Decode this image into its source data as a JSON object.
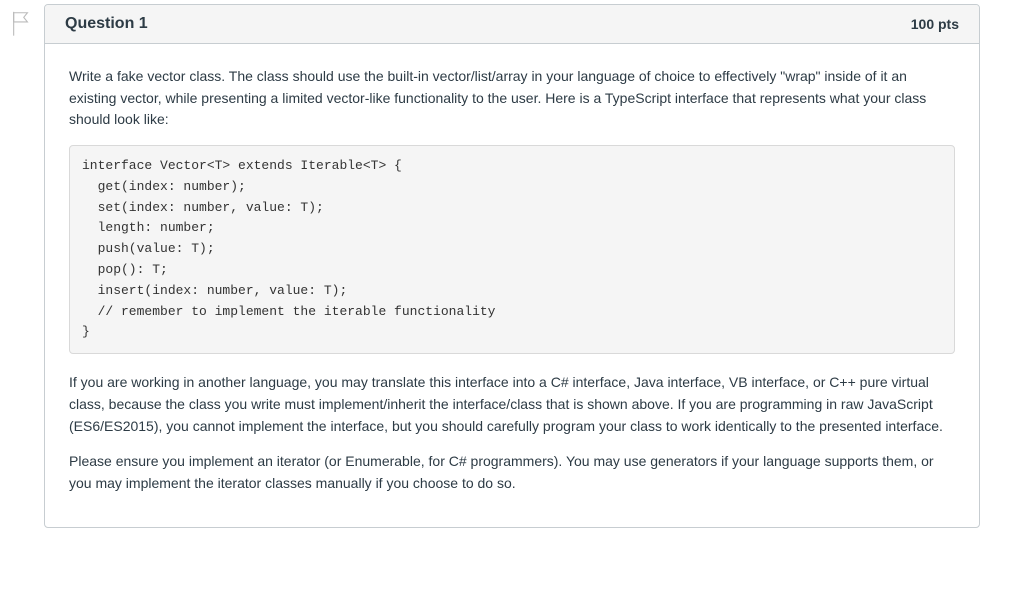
{
  "header": {
    "title": "Question 1",
    "points": "100 pts"
  },
  "content": {
    "intro": "Write a fake vector class. The class should use the built-in vector/list/array in your language of choice to effectively \"wrap\" inside of it an existing vector, while presenting a limited vector-like functionality to the user. Here is a TypeScript interface that represents what your class should look like:",
    "code": "interface Vector<T> extends Iterable<T> {\n  get(index: number);\n  set(index: number, value: T);\n  length: number;\n  push(value: T);\n  pop(): T;\n  insert(index: number, value: T);\n  // remember to implement the iterable functionality\n}",
    "paragraph2": "If you are working in another language, you may translate this interface into a C# interface, Java interface, VB interface, or C++ pure virtual class, because the class you write must implement/inherit the interface/class that is shown above. If you are programming in raw JavaScript (ES6/ES2015), you cannot implement the interface, but you should carefully program your class to work identically to the presented interface.",
    "paragraph3": "Please ensure you implement an iterator (or Enumerable, for C# programmers). You may use generators if your language supports them, or you may implement the iterator classes manually if you choose to do so."
  }
}
